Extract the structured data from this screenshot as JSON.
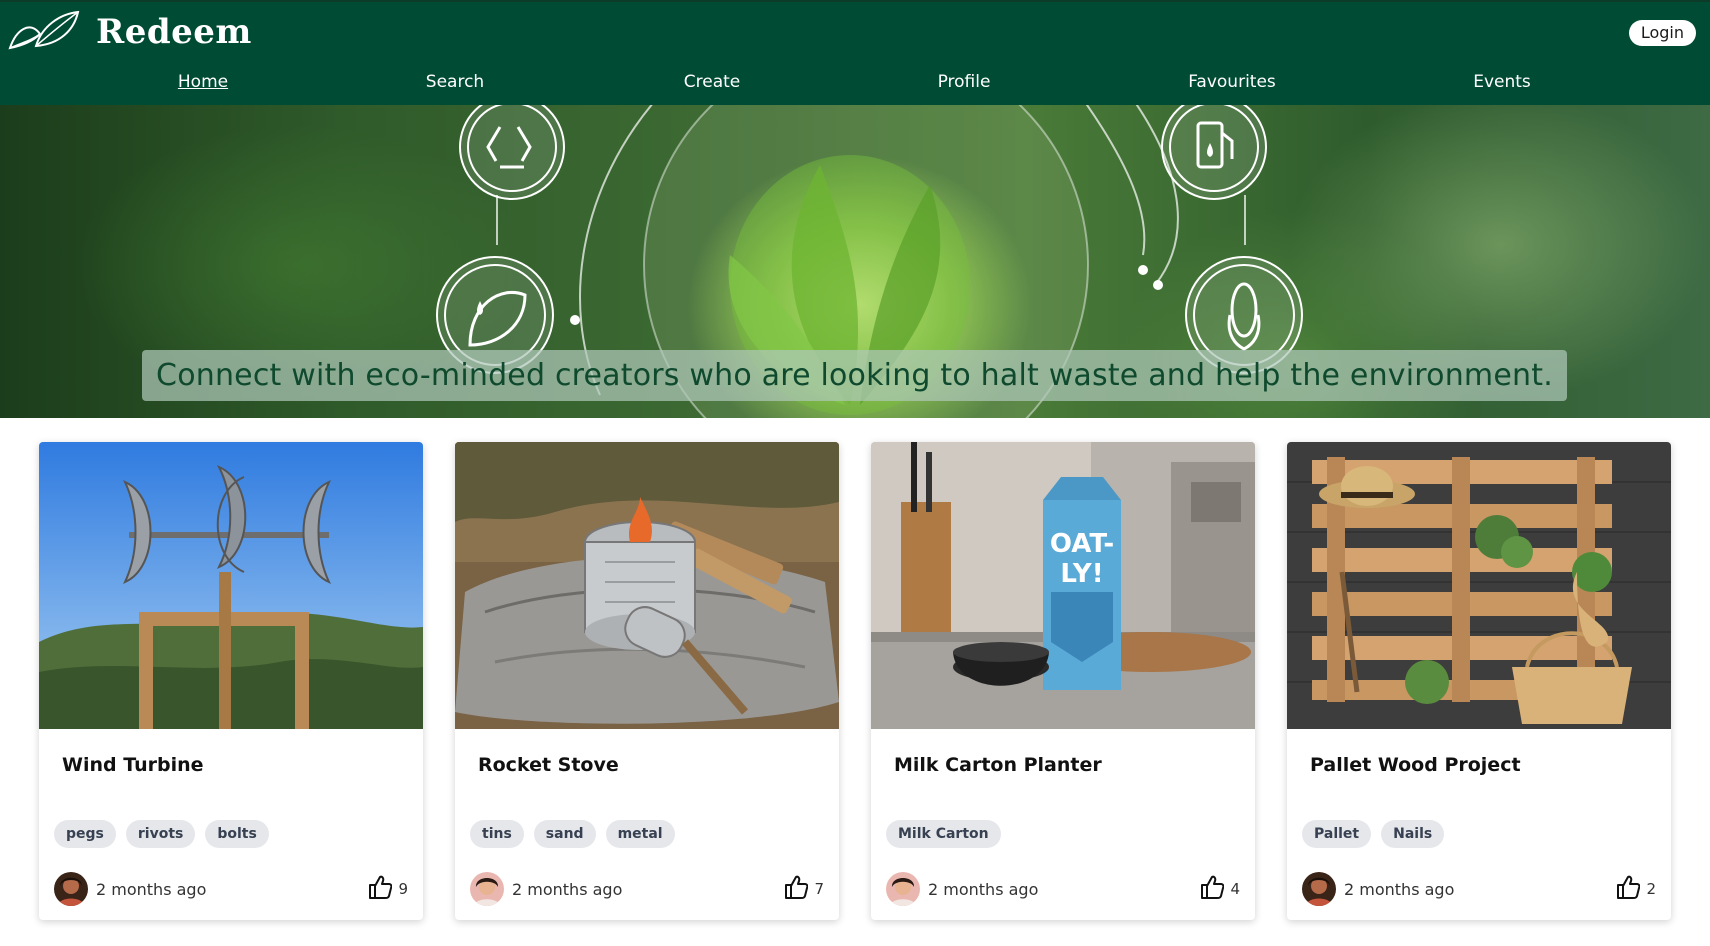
{
  "app": {
    "name": "Redeem",
    "login_label": "Login"
  },
  "nav": [
    {
      "label": "Home",
      "active": true
    },
    {
      "label": "Search"
    },
    {
      "label": "Create"
    },
    {
      "label": "Profile"
    },
    {
      "label": "Favourites"
    },
    {
      "label": "Events"
    }
  ],
  "hero": {
    "tagline": "Connect with eco-minded creators who are looking to halt waste and help the environment."
  },
  "cards": [
    {
      "title": "Wind Turbine",
      "tags": [
        "pegs",
        "rivots",
        "bolts"
      ],
      "time": "2 months ago",
      "likes": "9"
    },
    {
      "title": "Rocket Stove",
      "tags": [
        "tins",
        "sand",
        "metal"
      ],
      "time": "2 months ago",
      "likes": "7"
    },
    {
      "title": "Milk Carton Planter",
      "tags": [
        "Milk Carton"
      ],
      "time": "2 months ago",
      "likes": "4"
    },
    {
      "title": "Pallet Wood Project",
      "tags": [
        "Pallet",
        "Nails"
      ],
      "time": "2 months ago",
      "likes": "2"
    }
  ],
  "colors": {
    "brand": "#004b33",
    "tag_bg": "#e5e7eb",
    "banner_text": "#0f4a2e"
  },
  "icons": {
    "logo": "leaf-logo-icon",
    "like": "thumbs-up-icon",
    "hero": [
      "recycle-icon",
      "fuel-pump-icon",
      "leaf-drop-icon",
      "corn-icon"
    ]
  }
}
